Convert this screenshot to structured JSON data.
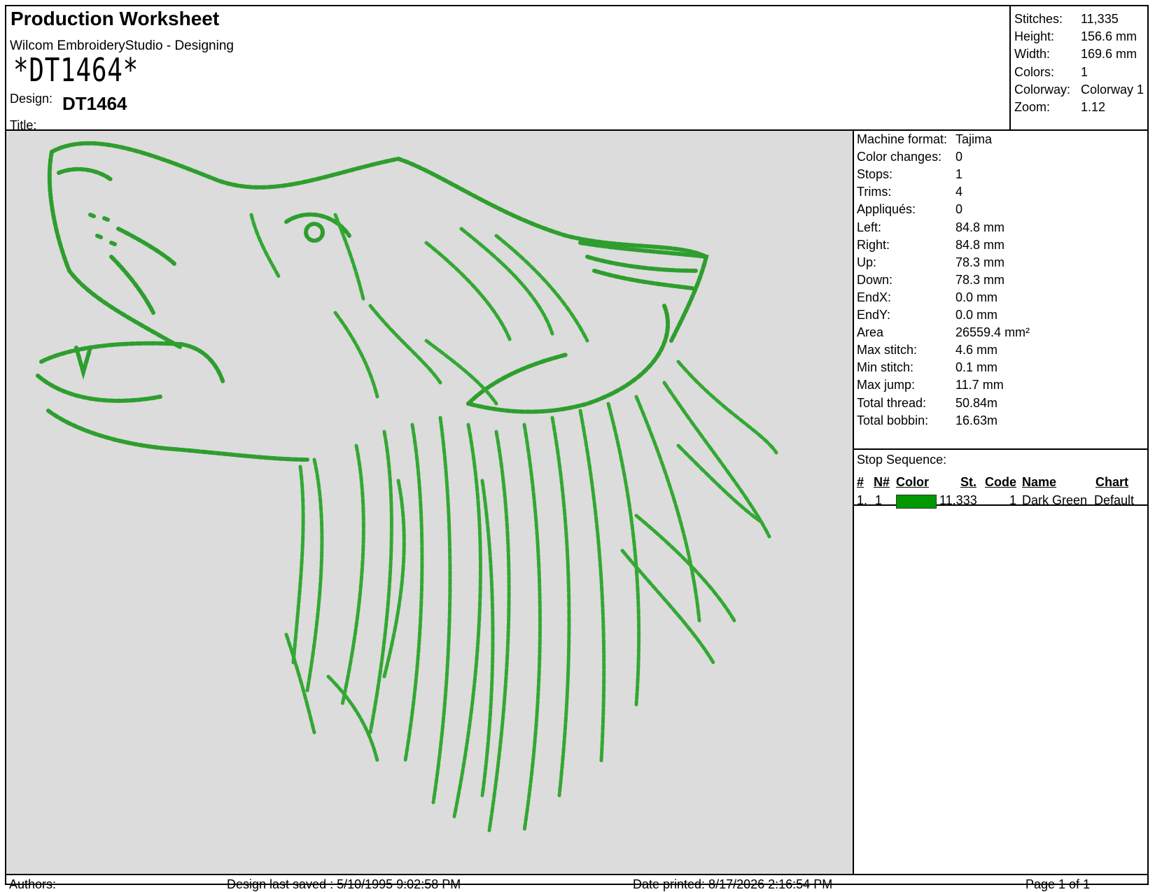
{
  "header": {
    "title": "Production Worksheet",
    "subtitle": "Wilcom EmbroideryStudio - Designing",
    "barcode_text": "*DT1464*",
    "design_label": "Design:",
    "design_value": "DT1464",
    "title_label": "Title:"
  },
  "summary": [
    {
      "label": "Stitches:",
      "value": "11,335"
    },
    {
      "label": "Height:",
      "value": "156.6 mm"
    },
    {
      "label": "Width:",
      "value": "169.6 mm"
    },
    {
      "label": "Colors:",
      "value": "1"
    },
    {
      "label": "Colorway:",
      "value": "Colorway 1"
    },
    {
      "label": "Zoom:",
      "value": "1.12"
    }
  ],
  "details": [
    {
      "label": "Machine format:",
      "value": "Tajima"
    },
    {
      "label": "Color changes:",
      "value": "0"
    },
    {
      "label": "Stops:",
      "value": "1"
    },
    {
      "label": "Trims:",
      "value": "4"
    },
    {
      "label": "Appliqués:",
      "value": "0"
    },
    {
      "label": "Left:",
      "value": "84.8 mm"
    },
    {
      "label": "Right:",
      "value": "84.8 mm"
    },
    {
      "label": "Up:",
      "value": "78.3 mm"
    },
    {
      "label": "Down:",
      "value": "78.3 mm"
    },
    {
      "label": "EndX:",
      "value": "0.0 mm"
    },
    {
      "label": "EndY:",
      "value": "0.0 mm"
    },
    {
      "label": "Area",
      "value": "26559.4 mm²"
    },
    {
      "label": "Max stitch:",
      "value": "4.6 mm"
    },
    {
      "label": "Min stitch:",
      "value": "0.1 mm"
    },
    {
      "label": "Max jump:",
      "value": "11.7 mm"
    },
    {
      "label": "Total thread:",
      "value": "50.84m"
    },
    {
      "label": "Total bobbin:",
      "value": "16.63m"
    }
  ],
  "stop_sequence": {
    "title": "Stop Sequence:",
    "headers": {
      "num": "#",
      "n": "N#",
      "color": "Color",
      "st": "St.",
      "code": "Code",
      "name": "Name",
      "chart": "Chart"
    },
    "rows": [
      {
        "num": "1.",
        "n": "1",
        "swatch": "#009900",
        "st": "11,333",
        "code": "1",
        "name": "Dark Green",
        "chart": "Default"
      }
    ]
  },
  "footer": {
    "authors": "Authors:",
    "last_saved": "Design last saved : 5/10/1995 9:02:58 PM",
    "printed": "Date printed: 8/17/2026 2:16:54 PM",
    "page": "Page 1 of 1"
  },
  "colors": {
    "thread": "#2e9e2e",
    "thread_dark": "#1f7a1f",
    "canvas": "#dcdcdc"
  },
  "design_image": {
    "subject": "howling-wolf-head-embroidery"
  }
}
